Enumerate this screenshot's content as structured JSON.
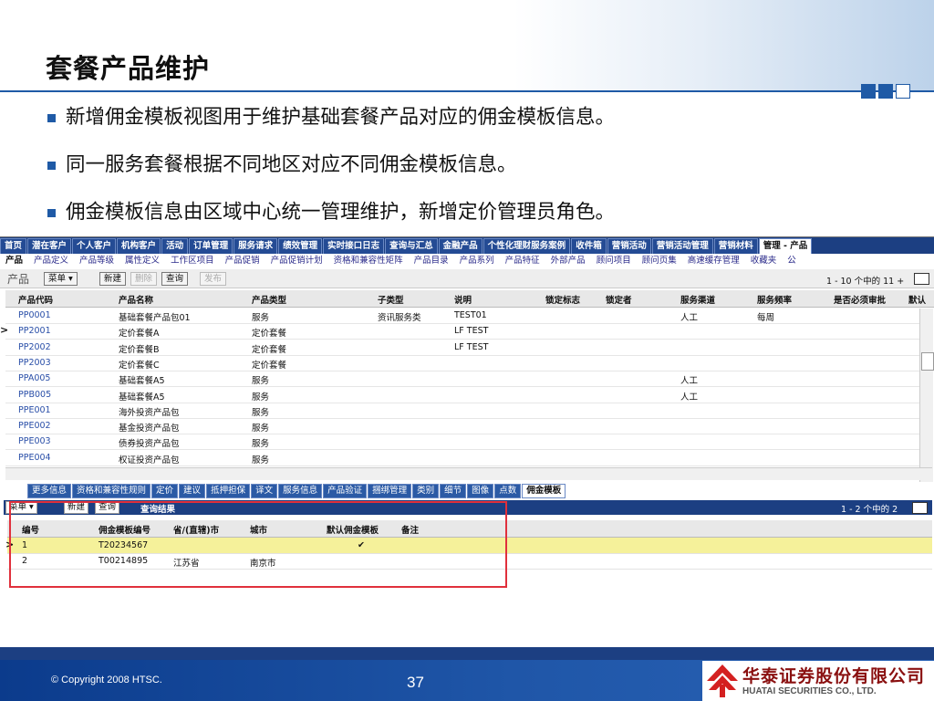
{
  "slide": {
    "title": "套餐产品维护",
    "bullets": [
      "新增佣金模板视图用于维护基础套餐产品对应的佣金模板信息。",
      "同一服务套餐根据不同地区对应不同佣金模板信息。",
      "佣金模板信息由区域中心统一管理维护，新增定价管理员角色。"
    ],
    "copyright": "© Copyright 2008 HTSC.",
    "page_number": "37",
    "logo_cn": "华泰证券股份有限公司",
    "logo_en": "HUATAI SECURITIES CO., LTD."
  },
  "app": {
    "main_tabs": [
      "首页",
      "潜在客户",
      "个人客户",
      "机构客户",
      "活动",
      "订单管理",
      "服务请求",
      "绩效管理",
      "实时接口日志",
      "查询与汇总",
      "金融产品",
      "个性化理财服务案例",
      "收件箱",
      "营销活动",
      "营销活动管理",
      "营销材料",
      "管理 - 产品"
    ],
    "active_main_tab": 16,
    "sub_tabs": [
      "产品",
      "产品定义",
      "产品等级",
      "属性定义",
      "工作区项目",
      "产品促销",
      "产品促销计划",
      "资格和兼容性矩阵",
      "产品目录",
      "产品系列",
      "产品特征",
      "外部产品",
      "顾问项目",
      "顾问页集",
      "高速缓存管理",
      "收藏夹",
      "公"
    ],
    "active_sub_tab": 0,
    "toolbar": {
      "label": "产品",
      "menu": "菜单",
      "new": "新建",
      "delete": "删除",
      "query": "查询",
      "publish": "发布",
      "pager": "1 - 10 个中的 11 +"
    },
    "grid": {
      "columns": [
        "产品代码",
        "产品名称",
        "产品类型",
        "子类型",
        "说明",
        "锁定标志",
        "锁定者",
        "服务渠道",
        "服务频率",
        "是否必须审批",
        "默认"
      ],
      "rows": [
        [
          "PP0001",
          "基础套餐产品包01",
          "服务",
          "资讯服务类",
          "TEST01",
          "",
          "",
          "人工",
          "每周",
          "",
          ""
        ],
        [
          "PP2001",
          "定价套餐A",
          "定价套餐",
          "",
          "LF TEST",
          "",
          "",
          "",
          "",
          "",
          ""
        ],
        [
          "PP2002",
          "定价套餐B",
          "定价套餐",
          "",
          "LF TEST",
          "",
          "",
          "",
          "",
          "",
          ""
        ],
        [
          "PP2003",
          "定价套餐C",
          "定价套餐",
          "",
          "",
          "",
          "",
          "",
          "",
          "",
          ""
        ],
        [
          "PPA005",
          "基础套餐A5",
          "服务",
          "",
          "",
          "",
          "",
          "人工",
          "",
          "",
          ""
        ],
        [
          "PPB005",
          "基础套餐A5",
          "服务",
          "",
          "",
          "",
          "",
          "人工",
          "",
          "",
          ""
        ],
        [
          "PPE001",
          "海外投资产品包",
          "服务",
          "",
          "",
          "",
          "",
          "",
          "",
          "",
          ""
        ],
        [
          "PPE002",
          "基金投资产品包",
          "服务",
          "",
          "",
          "",
          "",
          "",
          "",
          "",
          ""
        ],
        [
          "PPE003",
          "债券投资产品包",
          "服务",
          "",
          "",
          "",
          "",
          "",
          "",
          "",
          ""
        ],
        [
          "PPE004",
          "权证投资产品包",
          "服务",
          "",
          "",
          "",
          "",
          "",
          "",
          "",
          ""
        ]
      ],
      "selected_row": 1
    },
    "detail_tabs": [
      "更多信息",
      "资格和兼容性规则",
      "定价",
      "建议",
      "抵押担保",
      "译文",
      "服务信息",
      "产品验证",
      "捆绑管理",
      "类别",
      "细节",
      "图像",
      "点数",
      "佣金模板"
    ],
    "active_detail_tab": 13,
    "subgrid": {
      "menu": "菜单",
      "new": "新建",
      "query": "查询",
      "title": "查询结果",
      "pager": "1 - 2 个中的 2",
      "columns": [
        "编号",
        "佣金模板编号",
        "省/(直辖)市",
        "城市",
        "默认佣金模板",
        "备注"
      ],
      "rows": [
        [
          "1",
          "T20234567",
          "",
          "",
          "✔",
          ""
        ],
        [
          "2",
          "T00214895",
          "江苏省",
          "南京市",
          "",
          ""
        ]
      ],
      "selected_row": 0
    }
  }
}
